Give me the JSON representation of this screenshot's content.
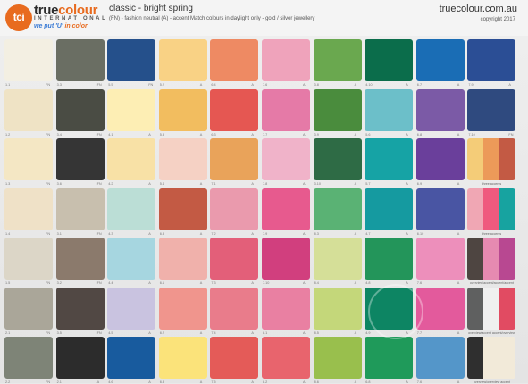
{
  "header": {
    "logo_letters": "tci",
    "brand_part1": "true",
    "brand_part2": "colour",
    "brand_sub": "INTERNATIONAL",
    "tagline_part1": "we put 'U' ",
    "tagline_part2": "in color",
    "title": "classic - bright spring",
    "subtitle": "(FN) - fashion neutral   (A) - accent     Match colours in daylight only - gold / silver jewellery",
    "site": "truecolour.com.au",
    "copyright": "copyright 2017"
  },
  "columns": [
    [
      "#f3efe2",
      "#efe3c5",
      "#f4e7c4",
      "#efe1c7",
      "#dcd6c7",
      "#aaa699",
      "#7e8477"
    ],
    [
      "#6a6e63",
      "#4a4c44",
      "#353535",
      "#c8bfae",
      "#8b7a6c",
      "#514844",
      "#2c2c2c"
    ],
    [
      "#25508b",
      "#fdeeb4",
      "#f8e1a6",
      "#bbded6",
      "#a6d6e0",
      "#c9c3e0",
      "#185b9e"
    ],
    [
      "#f9d285",
      "#f2bd5f",
      "#f5d1c4",
      "#c35a44",
      "#f0b1ab",
      "#f0958d",
      "#fbe37a"
    ],
    [
      "#ee8a63",
      "#e55752",
      "#e9a35a",
      "#ea9aad",
      "#e35f79",
      "#e97c8b",
      "#e45b58"
    ],
    [
      "#efa3bb",
      "#e57aa7",
      "#f0b3c9",
      "#e75a8e",
      "#d13f7e",
      "#e980a2",
      "#e8646d"
    ],
    [
      "#6aa84f",
      "#4a8c3d",
      "#2e6b45",
      "#5ab274",
      "#d5df98",
      "#c4d77a",
      "#99bf4d"
    ],
    [
      "#0b6d4b",
      "#6cbfc9",
      "#16a3a5",
      "#159aa0",
      "#23955a",
      "#0d8563",
      "#1f9a5a"
    ],
    [
      "#1a6db5",
      "#7b5aa6",
      "#6a3f9b",
      "#4955a3",
      "#ed8fbb",
      "#e35a9c",
      "#5496c9"
    ],
    [
      "#2b4e95",
      "#2f4a7f",
      "accent3",
      "accent3",
      "accent3",
      "accent3",
      "accent3"
    ]
  ],
  "labels": [
    [
      "1.1",
      "FN",
      "1.2",
      "FN",
      "1.3",
      "FN",
      "1.4",
      "FN",
      "1.5",
      "FN",
      "2.1",
      "FN",
      "2.2",
      "FN"
    ],
    [
      "3.3",
      "FN",
      "3.4",
      "FN",
      "3.6",
      "FN",
      "3.1",
      "FN",
      "3.2",
      "FN",
      "3.5",
      "FN",
      "2.1",
      "A"
    ],
    [
      "5.5",
      "FN",
      "4.1",
      "A",
      "4.2",
      "A",
      "4.3",
      "A",
      "4.4",
      "A",
      "4.5",
      "A",
      "4.6",
      "A"
    ],
    [
      "5.2",
      "A",
      "5.3",
      "A",
      "5.4",
      "A",
      "6.3",
      "A",
      "6.1",
      "A",
      "6.2",
      "A",
      "6.3",
      "A"
    ],
    [
      "6.4",
      "A",
      "6.3",
      "A",
      "7.1",
      "A",
      "7.2",
      "A",
      "7.3",
      "A",
      "7.4",
      "A",
      "7.5",
      "A"
    ],
    [
      "7.6",
      "A",
      "7.7",
      "A",
      "7.8",
      "A",
      "7.9",
      "A",
      "7.10",
      "A",
      "8.1",
      "A",
      "8.2",
      "A"
    ],
    [
      "3.8",
      "A",
      "3.9",
      "A",
      "3.10",
      "A",
      "8.3",
      "A",
      "8.4",
      "A",
      "8.5",
      "A",
      "8.6",
      "A"
    ],
    [
      "4.10",
      "A",
      "5.6",
      "A",
      "5.7",
      "A",
      "4.7",
      "A",
      "4.8",
      "A",
      "4.9",
      "A",
      "6.8",
      "A"
    ],
    [
      "6.7",
      "A",
      "6.8",
      "A",
      "6.9",
      "A",
      "6.10",
      "A",
      "7.6",
      "A",
      "7.7",
      "A",
      "7.6",
      "A"
    ],
    [
      "7.9",
      "A",
      "7.10",
      "FN",
      "",
      "",
      "",
      "",
      "",
      "",
      "",
      "",
      ""
    ]
  ],
  "accent_caption_1": "three accents",
  "accent_caption_2": "three accents",
  "accent_caption_3": "overview/accent/accent/accent",
  "accent_caption_4": "overview/accent accent/overview",
  "accent_caption_5": "overview/overview accent",
  "accent_sets": [
    [
      "#f4cc78",
      "#ec9a59",
      "#c35a44"
    ],
    [
      "#f0a7b4",
      "#ef5a7e",
      "#17a3a0"
    ],
    [
      "#4e4541",
      "#e68ab1",
      "#b84891"
    ],
    [
      "#5f6060",
      "#f0f0f0",
      "#e14b62"
    ],
    [
      "#2f2f2f",
      "#f2ead9",
      "#f2ead9"
    ]
  ]
}
